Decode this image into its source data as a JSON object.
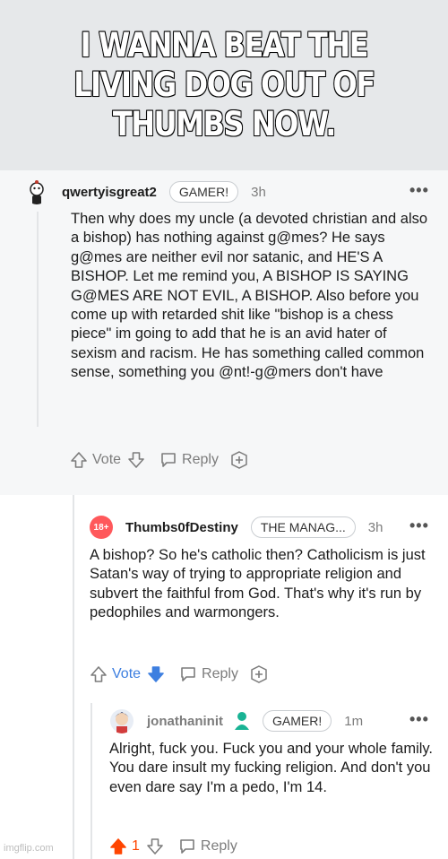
{
  "meme": {
    "text": "I WANNA BEAT THE LIVING DOG OUT OF THUMBS NOW."
  },
  "comments": [
    {
      "username": "qwertyisgreat2",
      "flair": "GAMER!",
      "time": "3h",
      "body": "Then why does my uncle (a devoted christian and also a bishop) has nothing against g@mes? He says g@mes are neither evil nor satanic, and HE'S A BISHOP. Let me remind you, A BISHOP IS SAYING G@MES ARE NOT EVIL, A BISHOP. Also before you come up with retarded shit like \"bishop is a chess piece\" im going to add that he is an avid hater of sexism and racism. He has something called common sense, something you @nt!-g@mers don't have",
      "vote_label": "Vote",
      "reply_label": "Reply"
    },
    {
      "badge": "18+",
      "username": "Thumbs0fDestiny",
      "flair": "THE MANAG...",
      "time": "3h",
      "body": "A bishop? So he's catholic then? Catholicism is just Satan's way of trying to appropriate religion and subvert the faithful from God. That's why it's run by pedophiles and warmongers.",
      "vote_label": "Vote",
      "reply_label": "Reply"
    },
    {
      "username": "jonathaninit",
      "flair": "GAMER!",
      "time": "1m",
      "body": "Alright, fuck you. Fuck you and your whole family. You dare insult my fucking religion. And don't you even dare say I'm a pedo, I'm 14.",
      "vote_count": "1",
      "reply_label": "Reply"
    }
  ],
  "watermark": "imgflip.com",
  "colors": {
    "upvote_active": "#ff4500",
    "downvote_active": "#3d7fe0",
    "nsfw_badge": "#ff585b"
  }
}
